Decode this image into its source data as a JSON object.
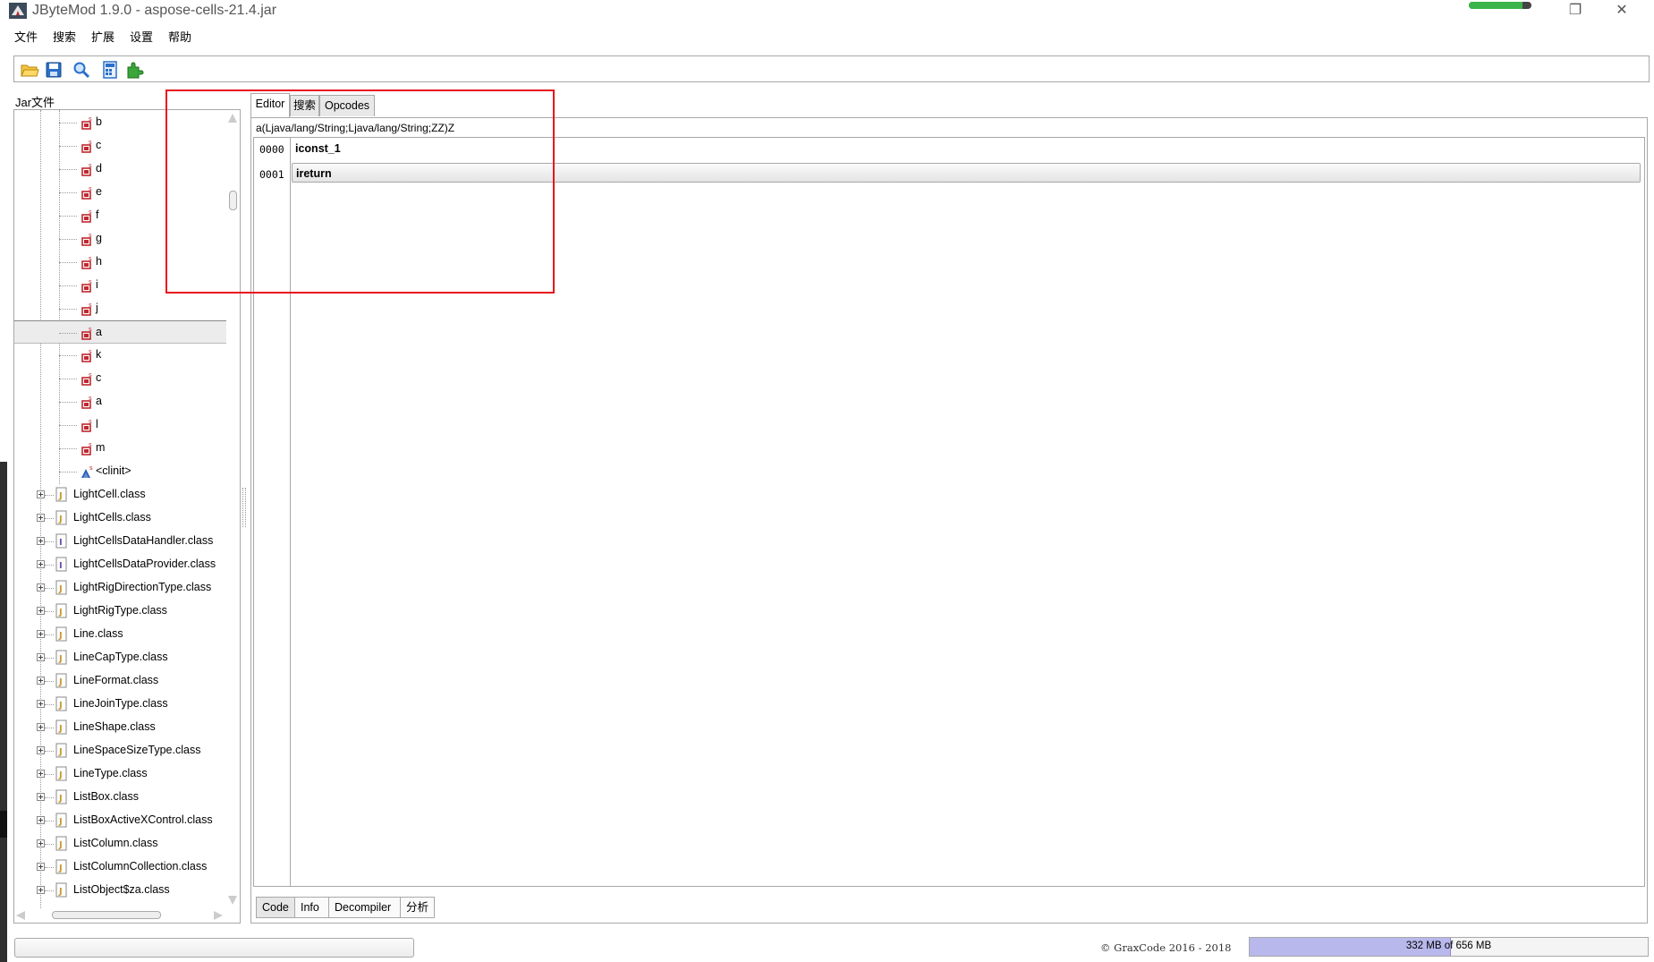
{
  "window": {
    "title": "JByteMod 1.9.0 - aspose-cells-21.4.jar",
    "restore_label": "❐",
    "close_label": "✕",
    "system_progress": 0.85
  },
  "menu": [
    "文件",
    "搜索",
    "扩展",
    "设置",
    "帮助"
  ],
  "toolbar": {
    "buttons": [
      "open-folder-icon",
      "save-icon",
      "search-icon",
      "calculator-icon",
      "plugin-icon"
    ]
  },
  "tree": {
    "label": "Jar文件",
    "methods": [
      {
        "name": "b"
      },
      {
        "name": "c"
      },
      {
        "name": "d"
      },
      {
        "name": "e"
      },
      {
        "name": "f"
      },
      {
        "name": "g"
      },
      {
        "name": "h"
      },
      {
        "name": "i"
      },
      {
        "name": "j"
      },
      {
        "name": "a",
        "selected": true
      },
      {
        "name": "k"
      },
      {
        "name": "c"
      },
      {
        "name": "a"
      },
      {
        "name": "l"
      },
      {
        "name": "m"
      },
      {
        "name": "<clinit>",
        "static": true
      }
    ],
    "classes": [
      {
        "name": "LightCell.class",
        "kind": "class"
      },
      {
        "name": "LightCells.class",
        "kind": "class"
      },
      {
        "name": "LightCellsDataHandler.class",
        "kind": "interface"
      },
      {
        "name": "LightCellsDataProvider.class",
        "kind": "interface"
      },
      {
        "name": "LightRigDirectionType.class",
        "kind": "class"
      },
      {
        "name": "LightRigType.class",
        "kind": "class"
      },
      {
        "name": "Line.class",
        "kind": "class"
      },
      {
        "name": "LineCapType.class",
        "kind": "class"
      },
      {
        "name": "LineFormat.class",
        "kind": "class"
      },
      {
        "name": "LineJoinType.class",
        "kind": "class"
      },
      {
        "name": "LineShape.class",
        "kind": "class"
      },
      {
        "name": "LineSpaceSizeType.class",
        "kind": "class"
      },
      {
        "name": "LineType.class",
        "kind": "class"
      },
      {
        "name": "ListBox.class",
        "kind": "class"
      },
      {
        "name": "ListBoxActiveXControl.class",
        "kind": "class"
      },
      {
        "name": "ListColumn.class",
        "kind": "class"
      },
      {
        "name": "ListColumnCollection.class",
        "kind": "class"
      },
      {
        "name": "ListObject$za.class",
        "kind": "class"
      }
    ]
  },
  "tabs": [
    {
      "label": "Editor",
      "active": true
    },
    {
      "label": "搜索",
      "active": false
    },
    {
      "label": "Opcodes",
      "active": false
    }
  ],
  "editor": {
    "method_signature": "a(Ljava/lang/String;Ljava/lang/String;ZZ)Z",
    "instructions": [
      {
        "offset": "0000",
        "text": "iconst_1"
      },
      {
        "offset": "0001",
        "text": "ireturn"
      }
    ],
    "bottom_tabs": [
      "Code",
      "Info",
      "Decompiler",
      "分析"
    ]
  },
  "status": {
    "copyright": "© GraxCode 2016 - 2018",
    "memory_text": "332 MB of 656 MB",
    "memory_used_fraction": 0.506
  },
  "colors": {
    "highlight": "#e8141c",
    "method_icon": "#c0282f",
    "class_icon": "#c89a2e",
    "interface_icon": "#6a52a8",
    "memory_fill": "#b8b8ec"
  }
}
